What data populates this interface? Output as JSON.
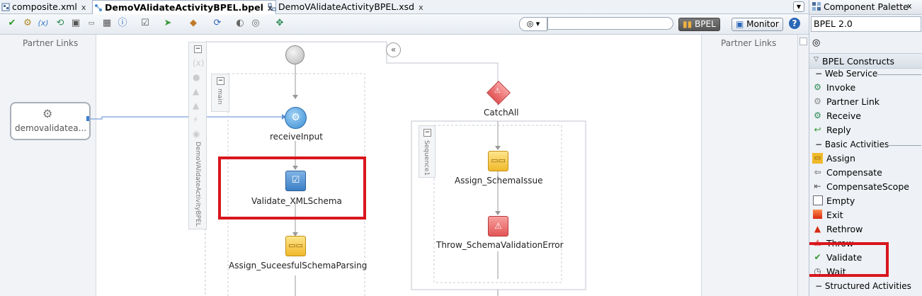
{
  "tabs": [
    {
      "label": "composite.xml",
      "close": "x",
      "active": false
    },
    {
      "label": "DemoVAlidateActivityBPEL.bpel",
      "close": "x",
      "active": true
    },
    {
      "label": "DemoVAlidateActivityBPEL.xsd",
      "close": "x",
      "active": false
    }
  ],
  "toolbar": {
    "search_value": "",
    "bpel_button": "BPEL",
    "monitor_button": "Monitor",
    "help_icon": "?"
  },
  "canvas": {
    "left_partner_links_title": "Partner Links",
    "right_partner_links_title": "Partner Links",
    "partner_link_name": "demovalidatea...",
    "process_label": "DemoVAlidateActivityBPEL",
    "main_scope_label": "main",
    "sequence_label": "Sequence1",
    "activities": {
      "receive": "receiveInput",
      "validate": "Validate_XMLSchema",
      "assign_success": "Assign_SuceesfulSchemaParsing",
      "catch_all": "CatchAll",
      "assign_issue": "Assign_SchemaIssue",
      "throw_error": "Throw_SchemaValidationError"
    }
  },
  "palette": {
    "title": "Component Palette",
    "close": "x",
    "selected_library": "BPEL 2.0",
    "constructs_header": "BPEL Constructs",
    "web_service_header": "Web Service",
    "web_service_items": [
      "Invoke",
      "Partner Link",
      "Receive",
      "Reply"
    ],
    "basic_activities_header": "Basic Activities",
    "basic_items": [
      "Assign",
      "Compensate",
      "CompensateScope",
      "Empty",
      "Exit",
      "Rethrow",
      "Throw",
      "Validate",
      "Wait"
    ],
    "structured_header": "Structured Activities"
  },
  "colors": {
    "highlight_red": "#d9161e",
    "receive_blue": "#3b8fd4",
    "assign_yellow": "#f6c23e",
    "throw_red": "#e25555"
  }
}
